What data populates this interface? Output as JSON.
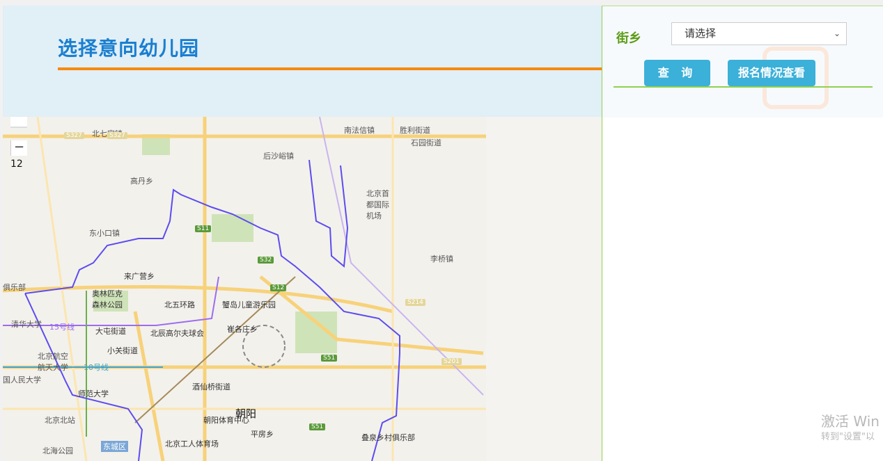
{
  "header": {
    "title": "选择意向幼儿园"
  },
  "map": {
    "zoom_level": "12",
    "zoom_out": "−",
    "district": "朝阳",
    "labels": [
      "北七家镇",
      "南法信镇",
      "胜利街道",
      "石园街道",
      "后沙峪镇",
      "高丹乡",
      "北京首都国际机场",
      "东小口镇",
      "李桥镇",
      "来广营乡",
      "奥林匹克森林公园",
      "北五环路",
      "蟹岛儿童游乐园",
      "清华大学",
      "大屯街道",
      "北辰高尔夫球会",
      "崔各庄乡",
      "小关街道",
      "北京航空航天大学",
      "10号线",
      "15号线",
      "酒仙桥街道",
      "师范大学",
      "朝阳体育中心",
      "北京工人体育场",
      "平房乡",
      "叠泉乡村俱乐部",
      "北京北站",
      "东城区",
      "北海公园",
      "国人民大学",
      "俱乐部"
    ],
    "shields": [
      "S327",
      "S327",
      "S11",
      "S32",
      "S12",
      "S51",
      "S51",
      "S214",
      "S201"
    ]
  },
  "panel": {
    "street_label": "街乡",
    "street_select": "请选择",
    "query_button": "查 询",
    "view_button": "报名情况查看"
  },
  "watermark": {
    "line1": "激活 Win",
    "line2": "转到\"设置\"以"
  },
  "colors": {
    "title": "#1a7fd0",
    "accent": "#f7890f",
    "button": "#3bb0d8",
    "green": "#8fd14f",
    "boundary": "#5b4cf0"
  }
}
